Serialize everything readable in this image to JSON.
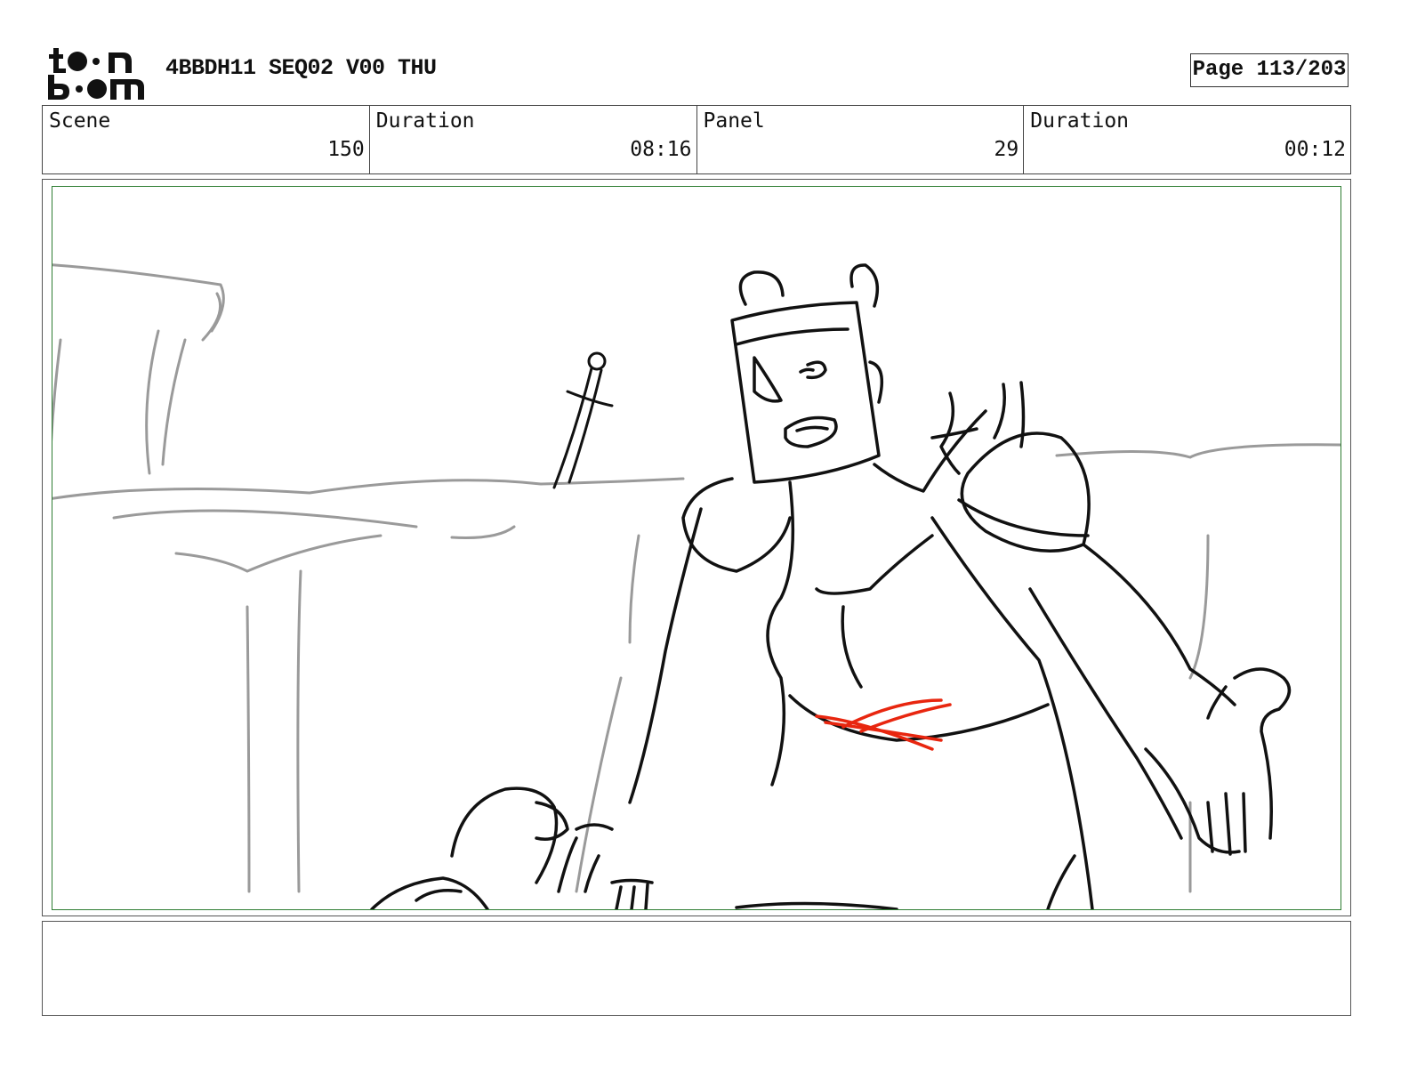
{
  "header": {
    "logo_text": "toon boom",
    "project_title": "4BBDH11 SEQ02 V00 THU",
    "page_label": "Page 113/203"
  },
  "info": {
    "scene_label": "Scene",
    "scene_value": "150",
    "scene_duration_label": "Duration",
    "scene_duration_value": "08:16",
    "panel_label": "Panel",
    "panel_value": "29",
    "panel_duration_label": "Duration",
    "panel_duration_value": "00:12"
  },
  "colors": {
    "frame_border": "#2e7d32",
    "sketch_line": "#111111",
    "background_line": "#9a9a9a",
    "accent_mark": "#e8260f"
  },
  "notes": {
    "dialogue": ""
  }
}
